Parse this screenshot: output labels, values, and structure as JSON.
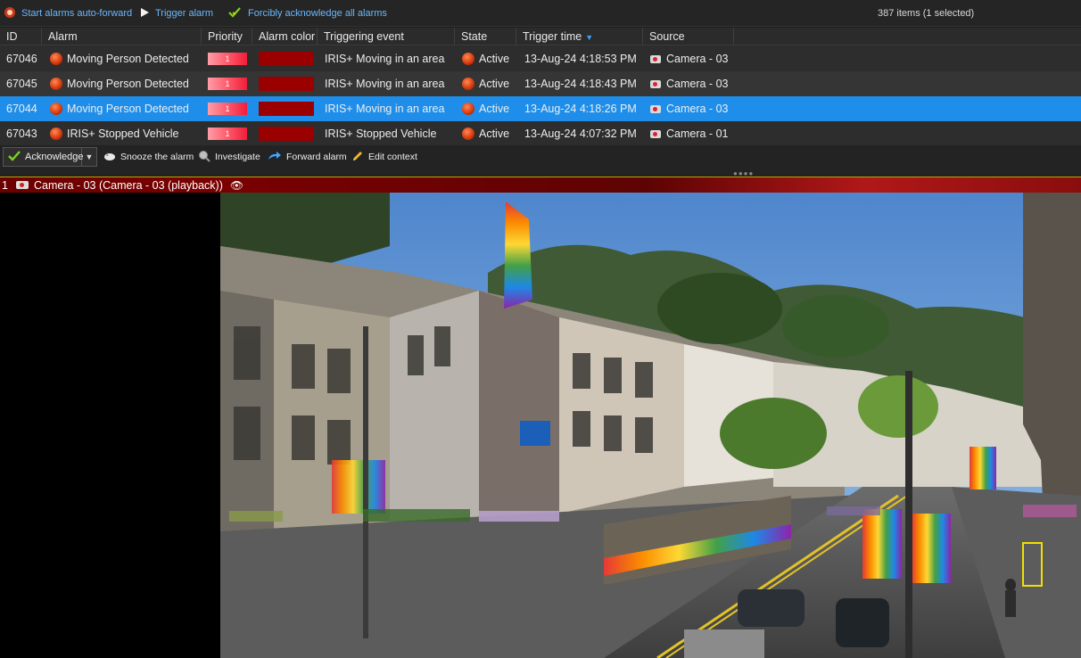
{
  "toolbar": {
    "auto_forward_label": "Start alarms auto-forward",
    "trigger_label": "Trigger alarm",
    "force_ack_label": "Forcibly acknowledge all alarms",
    "items_count": "387 items (1 selected)"
  },
  "table": {
    "columns": [
      "ID",
      "Alarm",
      "Priority",
      "Alarm color",
      "Triggering event",
      "State",
      "Trigger time",
      "Source"
    ],
    "sorted_column": "Trigger time",
    "sort_direction": "descending",
    "rows": [
      {
        "id": "67046",
        "alarm": "Moving Person Detected",
        "priority": "1",
        "alarm_color": "#9a0000",
        "event": "IRIS+ Moving in an area",
        "state": "Active",
        "time": "13-Aug-24 4:18:53 PM",
        "source": "Camera - 03",
        "selected": false
      },
      {
        "id": "67045",
        "alarm": "Moving Person Detected",
        "priority": "1",
        "alarm_color": "#9a0000",
        "event": "IRIS+ Moving in an area",
        "state": "Active",
        "time": "13-Aug-24 4:18:43 PM",
        "source": "Camera - 03",
        "selected": false
      },
      {
        "id": "67044",
        "alarm": "Moving Person Detected",
        "priority": "1",
        "alarm_color": "#9a0000",
        "event": "IRIS+ Moving in an area",
        "state": "Active",
        "time": "13-Aug-24 4:18:26 PM",
        "source": "Camera - 03",
        "selected": true
      },
      {
        "id": "67043",
        "alarm": "IRIS+ Stopped Vehicle",
        "priority": "1",
        "alarm_color": "#9a0000",
        "event": "IRIS+ Stopped Vehicle",
        "state": "Active",
        "time": "13-Aug-24 4:07:32 PM",
        "source": "Camera - 01",
        "selected": false
      }
    ]
  },
  "actions": {
    "acknowledge_label": "Acknowledge",
    "snooze_label": "Snooze the alarm",
    "investigate_label": "Investigate",
    "forward_label": "Forward alarm",
    "edit_context_label": "Edit context"
  },
  "tile": {
    "number": "1",
    "title": "Camera - 03 (Camera - 03 (playback))"
  },
  "colors": {
    "selection": "#1e8eea",
    "link": "#6ab7ff",
    "alarm_color": "#9a0000",
    "detection_box": "#f0e000"
  }
}
